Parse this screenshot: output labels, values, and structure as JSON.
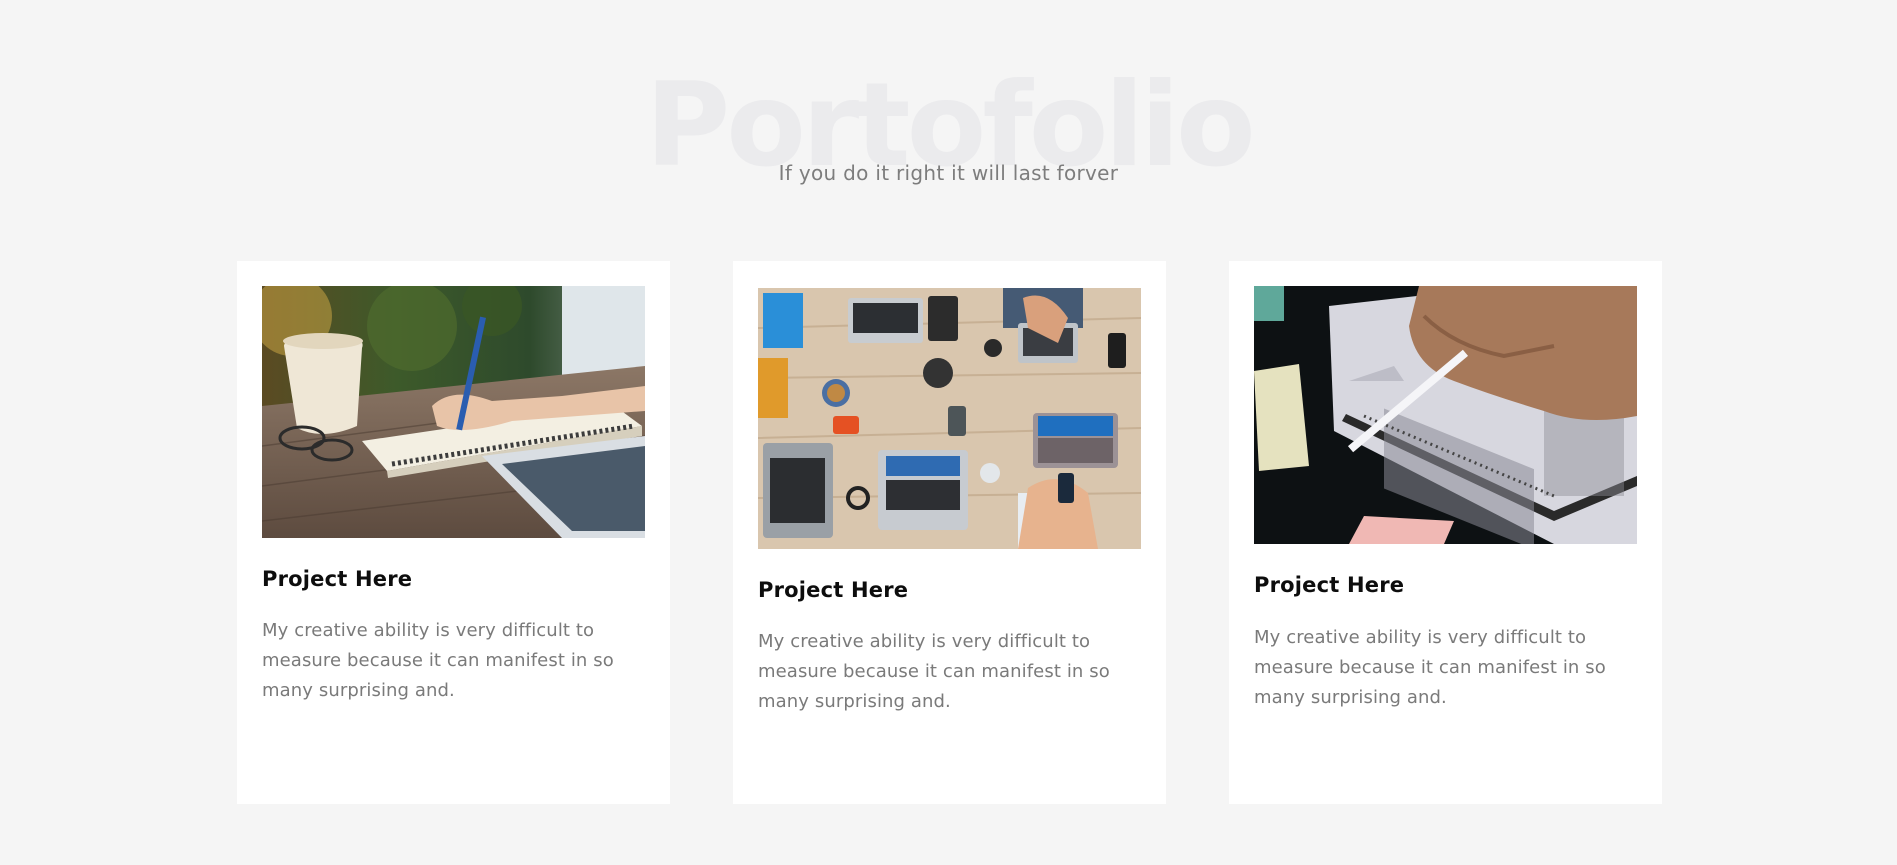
{
  "portfolio": {
    "title": "Portofolio",
    "subtitle": "If you do it right it will last forver"
  },
  "projects": [
    {
      "title": "Project Here",
      "description": "My creative ability is very difficult to measure because it can manifest in so many surprising and.",
      "image": "photo-writing-notebook"
    },
    {
      "title": "Project Here",
      "description": "My creative ability is very difficult to measure because it can manifest in so many surprising and.",
      "image": "photo-team-laptops-table"
    },
    {
      "title": "Project Here",
      "description": "My creative ability is very difficult to measure because it can manifest in so many surprising and.",
      "image": "photo-filling-answer-sheet"
    }
  ]
}
